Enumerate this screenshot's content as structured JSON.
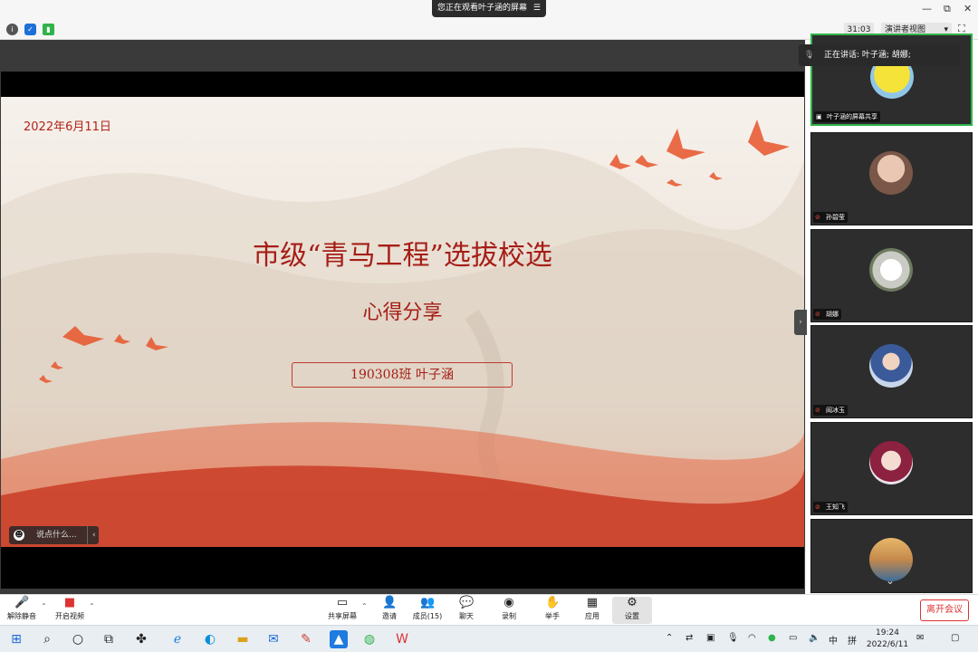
{
  "top": {
    "viewing_text": "您正在观看叶子涵的屏幕",
    "viewing_menu": "☰",
    "minimize": "—",
    "restore": "⧉",
    "close": "✕"
  },
  "infobar": {
    "timer": "31:03",
    "view_button": "演讲者视图",
    "view_caret": "▾",
    "fullscreen": "⛶"
  },
  "slide": {
    "date": "2022年6月11日",
    "title": "市级“青马工程”选拔校选",
    "subtitle": "心得分享",
    "name_box": "190308班 叶子涵"
  },
  "chat": {
    "placeholder": "说点什么...",
    "arrow": "‹"
  },
  "panel": {
    "speaking": "正在讲话: 叶子涵; 胡娜;",
    "collapse_arrow": "›",
    "participants": [
      {
        "name": "叶子涵的屏幕共享",
        "active": true
      },
      {
        "name": "孙碧莹",
        "active": false
      },
      {
        "name": "胡娜",
        "active": false
      },
      {
        "name": "阎冰玉",
        "active": false
      },
      {
        "name": "王知飞",
        "active": false
      },
      {
        "name": "",
        "active": false
      }
    ],
    "scroll_down": "⌄"
  },
  "toolbar": {
    "unmute": "解除静音",
    "start_video": "开启视频",
    "share_screen": "共享屏幕",
    "invite": "邀请",
    "members": "成员(15)",
    "chat": "聊天",
    "record": "录制",
    "raise_hand": "举手",
    "apps": "应用",
    "settings": "设置",
    "leave": "离开会议",
    "caret": "⌃"
  },
  "taskbar": {
    "time": "19:24",
    "date": "2022/6/11",
    "ime_lang": "中",
    "ime_mode": "拼"
  },
  "colors": {
    "accent_red": "#a61e16",
    "active_green": "#2fb34a",
    "leave_red": "#dd3333"
  }
}
